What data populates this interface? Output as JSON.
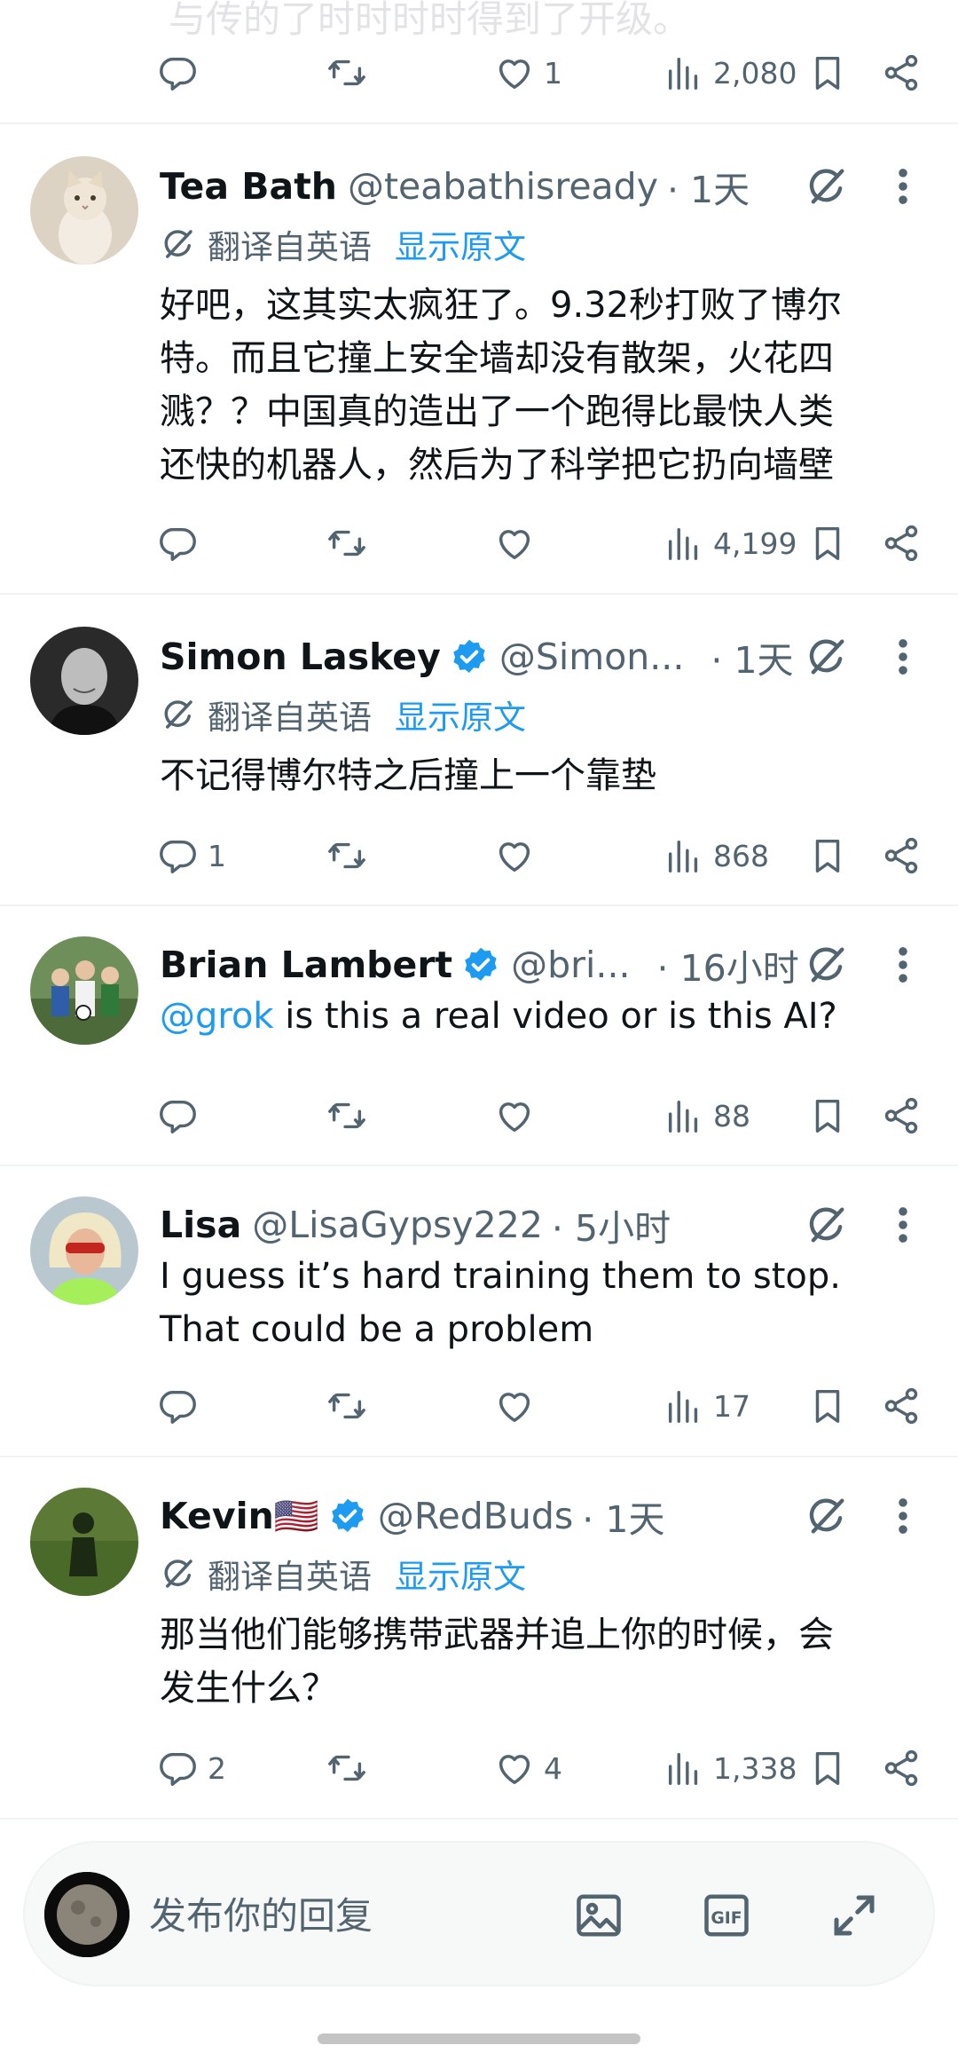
{
  "top_partial": {
    "ghost_text": "与传的了时时时时得到了开级。",
    "replies": "",
    "likes": "1",
    "views": "2,080"
  },
  "tweets": [
    {
      "name": "Tea Bath",
      "verified": false,
      "handle": "@teabathisready",
      "time": "· 1天",
      "translated_label": "翻译自英语",
      "show_original": "显示原文",
      "text_lines": [
        "好吧，这其实太疯狂了。9.32秒打败了博尔",
        "特。而且它撞上安全墙却没有散架，火花四",
        "溅？？中国真的造出了一个跑得比最快人类",
        "还快的机器人，然后为了科学把它扔向墙壁"
      ],
      "replies": "",
      "likes": "",
      "views": "4,199"
    },
    {
      "name": "Simon Laskey",
      "verified": true,
      "handle": "@Simon...",
      "time": "· 1天",
      "translated_label": "翻译自英语",
      "show_original": "显示原文",
      "text_lines": [
        "不记得博尔特之后撞上一个靠垫"
      ],
      "replies": "1",
      "likes": "",
      "views": "868"
    },
    {
      "name": "Brian Lambert",
      "verified": true,
      "handle": "@bri...",
      "time": "· 16小时",
      "mention": "@grok",
      "text_rest": " is this a real video or is this AI?",
      "replies": "",
      "likes": "",
      "views": "88"
    },
    {
      "name": "Lisa",
      "verified": false,
      "handle": "@LisaGypsy222",
      "time": "· 5小时",
      "text_lines": [
        "I guess it’s hard training them to stop.",
        "That could be a problem"
      ],
      "replies": "",
      "likes": "",
      "views": "17"
    },
    {
      "name": "Kevin🇺🇸",
      "verified": true,
      "handle": "@RedBuds",
      "time": "· 1天",
      "translated_label": "翻译自英语",
      "show_original": "显示原文",
      "text_lines": [
        "那当他们能够携带武器并追上你的时候，会",
        "发生什么？"
      ],
      "replies": "2",
      "likes": "4",
      "views": "1,338"
    }
  ],
  "composer": {
    "placeholder": "发布你的回复"
  },
  "colors": {
    "accent": "#1d9bf0",
    "text": "#0f1419",
    "secondary": "#536471",
    "divider": "#eff3f4"
  }
}
